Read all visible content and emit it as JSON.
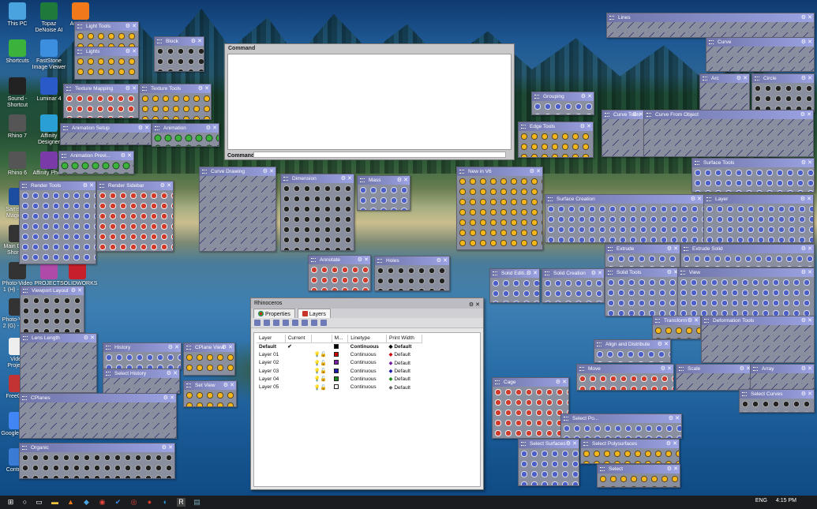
{
  "desktop_icons": [
    {
      "label": "This PC",
      "icon": "computer-icon",
      "color": "#4aa3df"
    },
    {
      "label": "Shortcuts",
      "icon": "arrow-icon",
      "color": "#3bb23b"
    },
    {
      "label": "Sound - Shortcut",
      "icon": "speaker-icon",
      "color": "#222222"
    },
    {
      "label": "Rhino 7",
      "icon": "rhino-icon",
      "color": "#555555"
    },
    {
      "label": "Rhino 6",
      "icon": "rhino-icon",
      "color": "#555555"
    },
    {
      "label": "Samsung Magician",
      "icon": "samsung-icon",
      "color": "#1a4ca0"
    },
    {
      "label": "Main Disk - Shortcut",
      "icon": "disk-icon",
      "color": "#333333"
    },
    {
      "label": "Photo-Video 1 (H) - Sh...",
      "icon": "disk-icon",
      "color": "#333333"
    },
    {
      "label": "Photo-Video 2 (G) - Sh...",
      "icon": "disk-icon",
      "color": "#333333"
    },
    {
      "label": "Video Projects",
      "icon": "folder-icon",
      "color": "#eeeeee"
    },
    {
      "label": "FreeCAD",
      "icon": "freecad-icon",
      "color": "#c33333"
    },
    {
      "label": "Google Pre...",
      "icon": "google-icon",
      "color": "#4285f4"
    },
    {
      "label": "Control...",
      "icon": "control-panel-icon",
      "color": "#3a7bd5"
    },
    {
      "label": "Topaz DeNoise AI",
      "icon": "topaz-icon",
      "color": "#1e7a3a"
    },
    {
      "label": "FastStone Image Viewer",
      "icon": "faststone-icon",
      "color": "#3c8ede"
    },
    {
      "label": "Luminar 4",
      "icon": "luminar-icon",
      "color": "#2a5ac7"
    },
    {
      "label": "Affinity Designer",
      "icon": "affinity-designer-icon",
      "color": "#2a9fd6"
    },
    {
      "label": "Affinity Photo",
      "icon": "affinity-photo-icon",
      "color": "#7a3aa8"
    },
    {
      "label": "PROJECTS",
      "icon": "projects-icon",
      "color": "#b04aa8"
    },
    {
      "label": "SOLIDWORKS 2020",
      "icon": "solidworks-icon",
      "color": "#c8202a"
    },
    {
      "label": "Audacity",
      "icon": "audacity-icon",
      "color": "#f07a1a"
    }
  ],
  "command": {
    "title": "Command",
    "prompt": "Command:"
  },
  "toolbars": [
    "Light Tools",
    "Lights",
    "Block",
    "Texture Mapping",
    "Texture Tools",
    "Animation Setup",
    "Animation",
    "Animation Previ...",
    "Render Tools",
    "Render Sidebar",
    "Curve Drawing",
    "Dimension",
    "Mass",
    "New in V6",
    "Grouping",
    "Edge Tools",
    "Lines",
    "Curve",
    "Arc",
    "Circle",
    "Curve Tools",
    "Curve From Object",
    "Surface Tools",
    "Surface Creation",
    "Layer",
    "Annotate",
    "Holes",
    "Solid Editi...",
    "Solid Creation",
    "Extrude",
    "Extrude Solid",
    "Solid Tools",
    "View",
    "Viewport Layout",
    "Lens Length",
    "History",
    "CPlane View",
    "Select History",
    "Set View",
    "CPlanes",
    "Organic",
    "Cage",
    "Transform",
    "Deformation Tools",
    "Align and Distribute",
    "Move",
    "Scale",
    "Array",
    "Select Curves",
    "Select Po...",
    "Select Surfaces",
    "Select Polysurfaces",
    "Select"
  ],
  "rhinoceros": {
    "title": "Rhinoceros",
    "tabs": [
      {
        "label": "Properties"
      },
      {
        "label": "Layers"
      }
    ],
    "columns": [
      "Layer",
      "Current",
      "",
      "M...",
      "Linetype",
      "Print Width"
    ],
    "rows": [
      {
        "name": "Default",
        "current": "✔",
        "color": "#000000",
        "linetype": "Continuous",
        "print_width": "Default"
      },
      {
        "name": "Layer 01",
        "current": "",
        "color": "#cc0000",
        "linetype": "Continuous",
        "print_width": "Default"
      },
      {
        "name": "Layer 02",
        "current": "",
        "color": "#7a1fa8",
        "linetype": "Continuous",
        "print_width": "Default"
      },
      {
        "name": "Layer 03",
        "current": "",
        "color": "#1a1ab0",
        "linetype": "Continuous",
        "print_width": "Default"
      },
      {
        "name": "Layer 04",
        "current": "",
        "color": "#1e8a1e",
        "linetype": "Continuous",
        "print_width": "Default"
      },
      {
        "name": "Layer 05",
        "current": "",
        "color": "#ffffff",
        "linetype": "Continuous",
        "print_width": "Default"
      }
    ]
  },
  "taskbar": {
    "language": "ENG",
    "time": "4:15 PM"
  }
}
